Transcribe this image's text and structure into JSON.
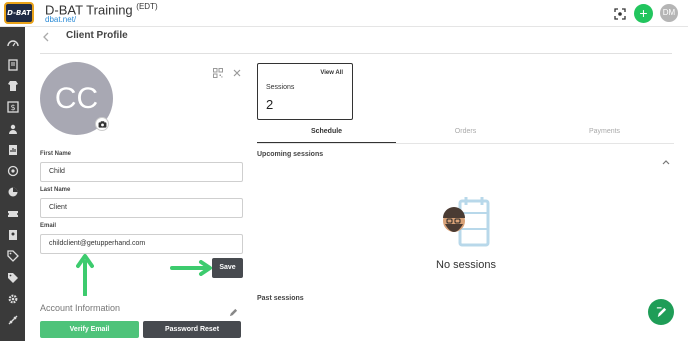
{
  "header": {
    "logo_text": "D-BAT",
    "title": "D-BAT Training",
    "title_suffix": "(EDT)",
    "url": "dbat.net/",
    "add_label": "+",
    "avatar_initials": "DM",
    "accent": "#22c55e"
  },
  "sidebar": {
    "icons": [
      "dashboard-icon",
      "book-icon",
      "jersey-icon",
      "dollar-icon",
      "users-icon",
      "report-icon",
      "target-icon",
      "pie-chart-icon",
      "ticket-icon",
      "contacts-icon",
      "tag-icon",
      "tag-alt-icon",
      "gear-icon",
      "fitness-icon"
    ]
  },
  "page": {
    "title": "Client Profile"
  },
  "profile": {
    "initials": "CC",
    "first_name_label": "First Name",
    "first_name": "Child",
    "last_name_label": "Last Name",
    "last_name": "Client",
    "email_label": "Email",
    "email": "childclient@getupperhand.com",
    "save_label": "Save",
    "account_info_label": "Account Information",
    "verify_email_label": "Verify Email",
    "password_reset_label": "Password Reset"
  },
  "sessions_card": {
    "view_all": "View All",
    "label": "Sessions",
    "count": "2"
  },
  "tabs": [
    {
      "label": "Schedule",
      "active": true
    },
    {
      "label": "Orders",
      "active": false
    },
    {
      "label": "Payments",
      "active": false
    }
  ],
  "schedule": {
    "upcoming_label": "Upcoming sessions",
    "empty_text": "No sessions",
    "past_label": "Past sessions"
  },
  "colors": {
    "sidebar": "#3a3a3a",
    "green": "#4ec37a",
    "dark_button": "#474a4f"
  }
}
